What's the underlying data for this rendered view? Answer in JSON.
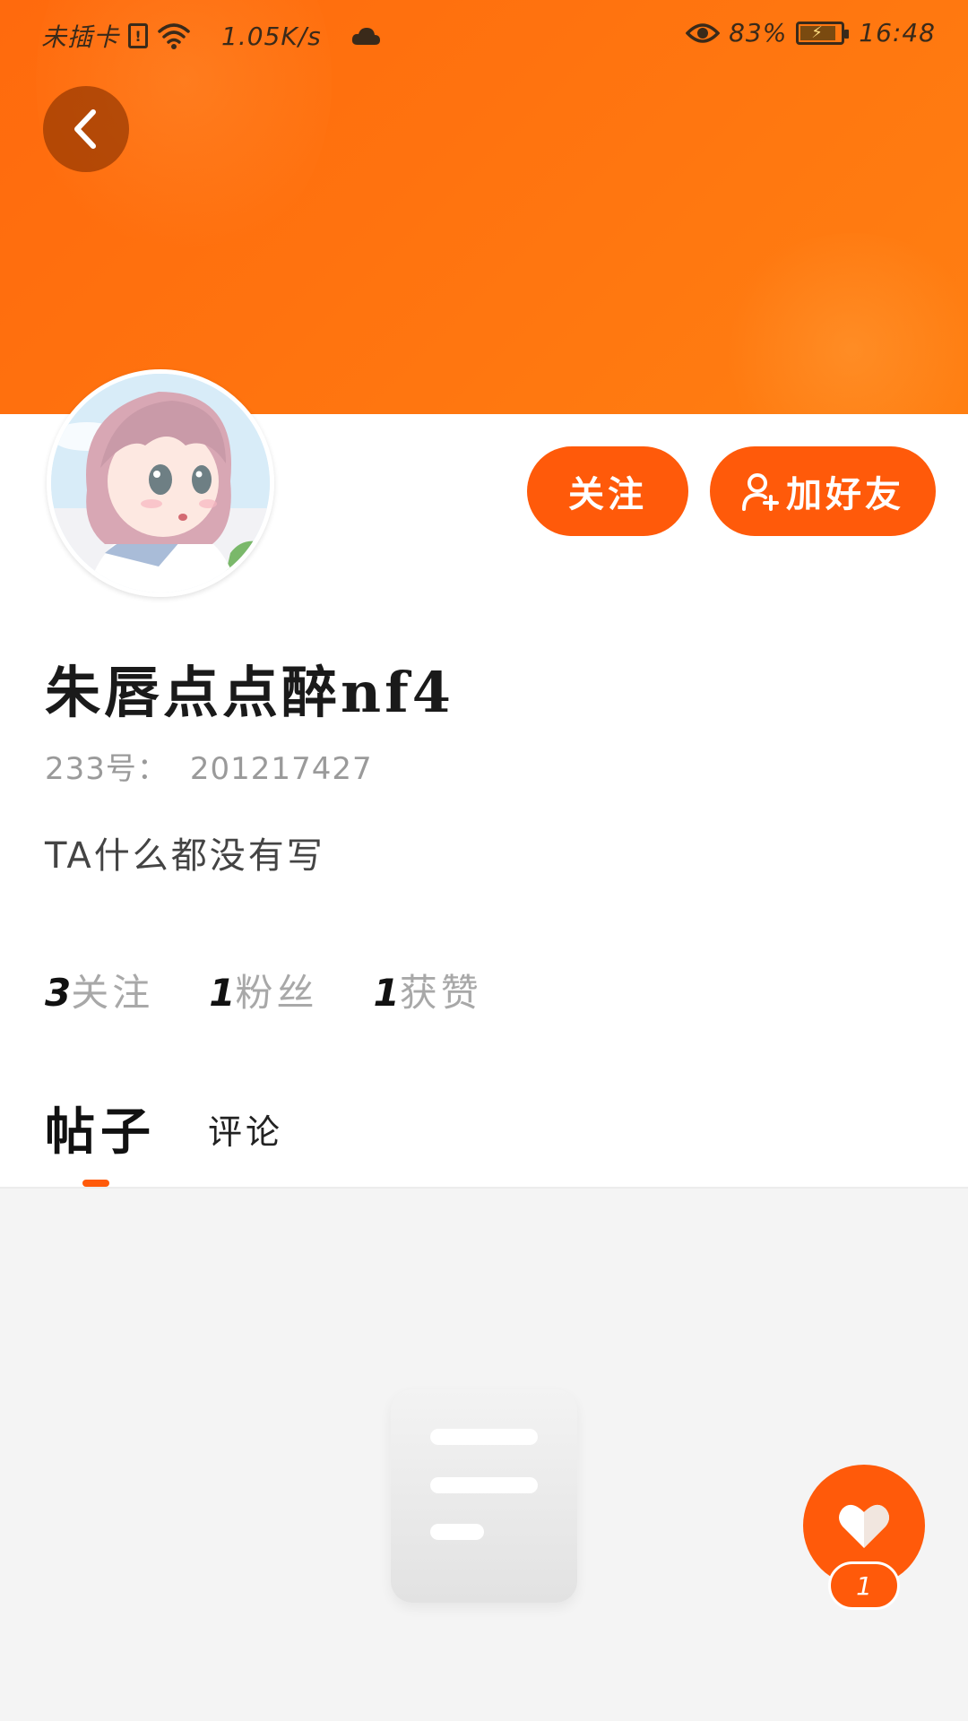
{
  "status_bar": {
    "carrier": "未插卡",
    "network_speed": "1.05K/s",
    "battery": "83%",
    "time": "16:48",
    "icons": [
      "sim-alert-icon",
      "wifi-icon",
      "cloud-icon",
      "eye-icon",
      "battery-charging-icon"
    ]
  },
  "header": {
    "back_icon": "chevron-left-icon"
  },
  "actions": {
    "follow_label": "关注",
    "add_friend_label": "加好友",
    "add_friend_icon": "add-user-icon"
  },
  "profile": {
    "username": "朱唇点点醉nf4",
    "id_label": "233号：",
    "id_value": "201217427",
    "bio": "TA什么都没有写"
  },
  "stats": [
    {
      "num": "3",
      "label": "关注"
    },
    {
      "num": "1",
      "label": "粉丝"
    },
    {
      "num": "1",
      "label": "获赞"
    }
  ],
  "tabs": [
    {
      "label": "帖子",
      "active": true
    },
    {
      "label": "评论",
      "active": false
    }
  ],
  "like_button": {
    "icon": "heart-icon",
    "count": "1"
  },
  "colors": {
    "accent": "#ff5a0a",
    "banner": "#ff730f",
    "content_bg": "#f4f4f4"
  }
}
